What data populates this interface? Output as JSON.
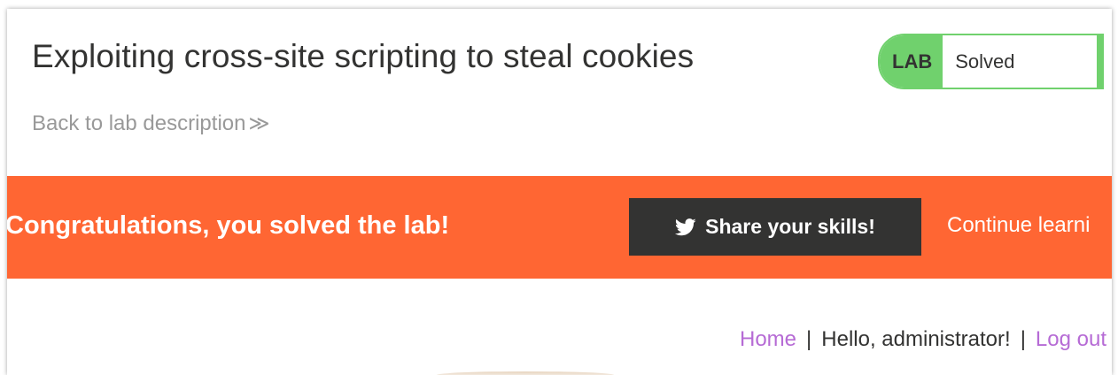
{
  "lab": {
    "title": "Exploiting cross-site scripting to steal cookies",
    "badge": "LAB",
    "status": "Solved",
    "back_link": "Back to lab description",
    "back_chevron": "≫"
  },
  "banner": {
    "message": "Congratulations, you solved the lab!",
    "share_label": "Share your skills!",
    "share_icon": "twitter-bird-icon",
    "continue_label": "Continue learni"
  },
  "nav": {
    "home": "Home",
    "separator": "|",
    "greeting": "Hello, administrator!",
    "logout": "Log out"
  },
  "colors": {
    "banner": "#ff6633",
    "solved_green": "#70d16d",
    "button_dark": "#333332",
    "link_purple": "#b66bd5"
  }
}
